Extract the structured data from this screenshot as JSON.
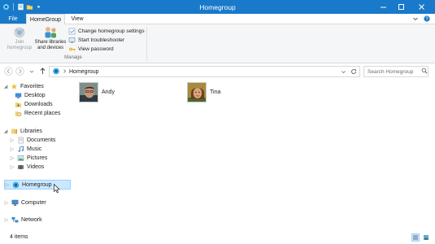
{
  "window": {
    "title": "Homegroup",
    "accent_color": "#1979ca"
  },
  "quick_access": {
    "icons": [
      "homegroup-small-icon",
      "properties-icon",
      "new-folder-icon",
      "customize-dropdown-icon"
    ]
  },
  "tabs": [
    {
      "label": "File",
      "active": false
    },
    {
      "label": "HomeGroup",
      "active": true
    },
    {
      "label": "View",
      "active": false
    }
  ],
  "ribbon": {
    "join_label": "Join homegroup",
    "share_label": "Share libraries and devices",
    "commands": [
      {
        "label": "Change homegroup settings",
        "icon": "settings-page-icon"
      },
      {
        "label": "Start troubleshooter",
        "icon": "troubleshooter-icon"
      },
      {
        "label": "View password",
        "icon": "key-icon"
      }
    ],
    "group_label": "Manage"
  },
  "address": {
    "location": "Homegroup",
    "search_placeholder": "Search Homegroup"
  },
  "navpane": {
    "favorites": {
      "label": "Favorites",
      "items": [
        "Desktop",
        "Downloads",
        "Recent places"
      ]
    },
    "libraries": {
      "label": "Libraries",
      "items": [
        "Documents",
        "Music",
        "Pictures",
        "Videos"
      ]
    },
    "homegroup": "Homegroup",
    "computer": "Computer",
    "network": "Network"
  },
  "users": [
    {
      "name": "Andy"
    },
    {
      "name": "Tina"
    }
  ],
  "status": {
    "count": "4 items"
  }
}
